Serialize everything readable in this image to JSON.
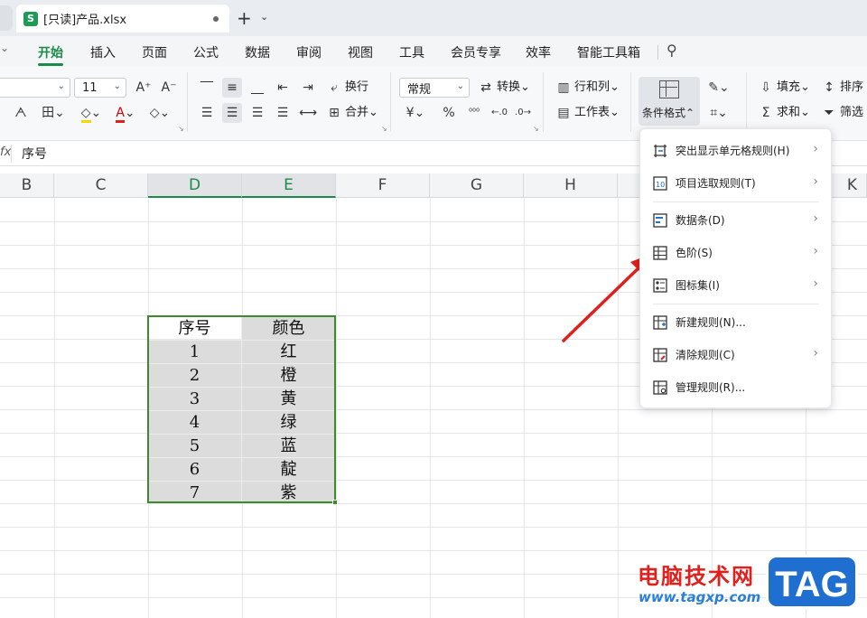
{
  "window": {
    "tab_title": "[只读]产品.xlsx",
    "app_badge": "S",
    "new_tab": "+",
    "tab_menu": "⌄"
  },
  "menu": {
    "items": [
      "开始",
      "插入",
      "页面",
      "公式",
      "数据",
      "审阅",
      "视图",
      "工具",
      "会员专享",
      "效率",
      "智能工具箱"
    ],
    "active": "开始"
  },
  "ribbon": {
    "font_size": "11",
    "number_format": "常规",
    "wrap_label": "换行",
    "merge_label": "合并",
    "convert_label": "转换",
    "rowcol_label": "行和列",
    "sheet_label": "工作表",
    "conditional_format_label": "条件格式",
    "fill_label": "填充",
    "sort_label": "排序",
    "sum_label": "求和",
    "filter_label": "筛选",
    "percent": "%",
    "currency": "¥"
  },
  "formula_bar": {
    "fx": "fx",
    "content": "序号"
  },
  "columns": [
    "B",
    "C",
    "D",
    "E",
    "F",
    "G",
    "H",
    "K"
  ],
  "table": {
    "headers": [
      "序号",
      "颜色"
    ],
    "rows": [
      [
        "1",
        "红"
      ],
      [
        "2",
        "橙"
      ],
      [
        "3",
        "黄"
      ],
      [
        "4",
        "绿"
      ],
      [
        "5",
        "蓝"
      ],
      [
        "6",
        "靛"
      ],
      [
        "7",
        "紫"
      ]
    ]
  },
  "dropdown": {
    "items": [
      {
        "label": "突出显示单元格规则(H)",
        "submenu": true
      },
      {
        "label": "项目选取规则(T)",
        "submenu": true
      },
      {
        "label": "数据条(D)",
        "submenu": true
      },
      {
        "label": "色阶(S)",
        "submenu": true
      },
      {
        "label": "图标集(I)",
        "submenu": true
      },
      {
        "label": "新建规则(N)...",
        "submenu": false
      },
      {
        "label": "清除规则(C)",
        "submenu": true
      },
      {
        "label": "管理规则(R)...",
        "submenu": false
      }
    ]
  },
  "watermark": {
    "site_name": "电脑技术网",
    "url": "www.tagxp.com",
    "tag": "TAG"
  },
  "colors": {
    "accent_green": "#1b8a4a",
    "selection_border": "#3d8a2e",
    "arrow_red": "#e0201c"
  }
}
